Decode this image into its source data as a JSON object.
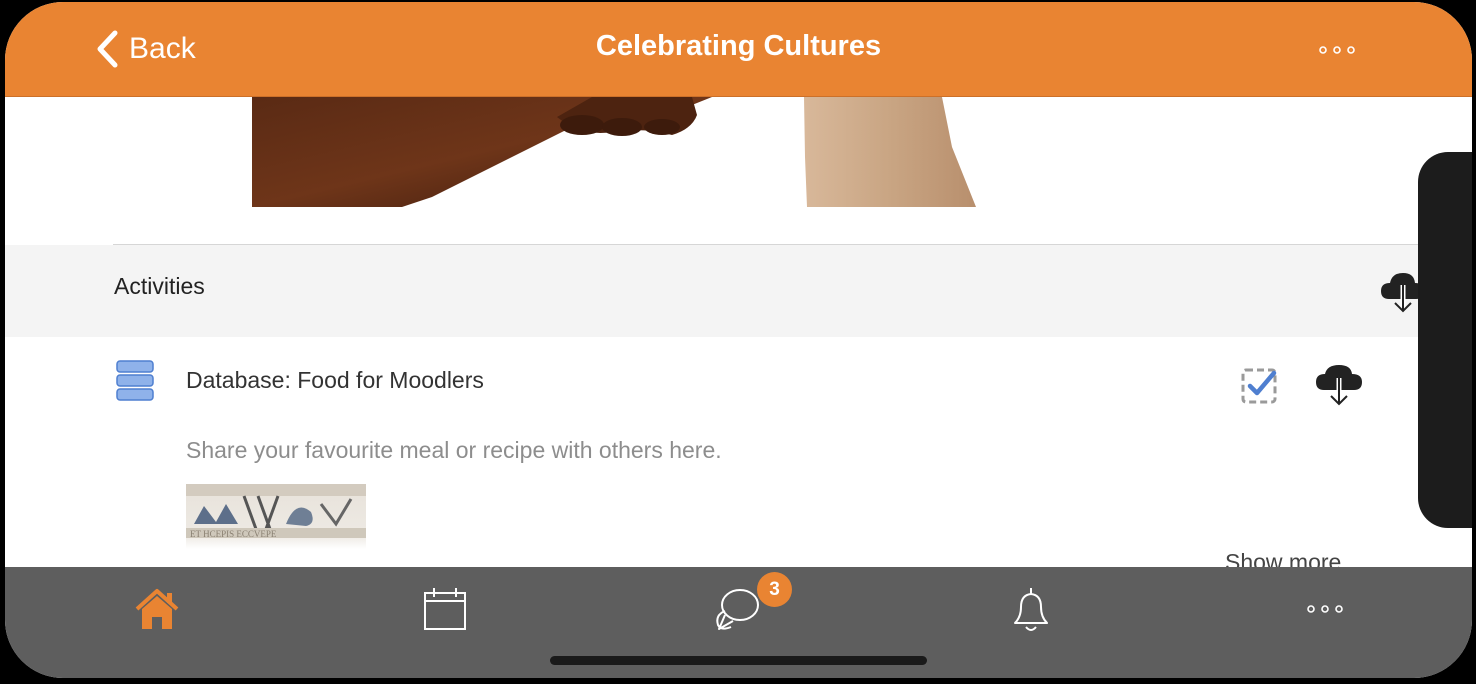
{
  "header": {
    "back_label": "Back",
    "title": "Celebrating Cultures"
  },
  "section": {
    "title": "Activities"
  },
  "module": {
    "title": "Database: Food for Moodlers",
    "description": "Share your favourite meal or recipe with others here.",
    "show_more": "Show more"
  },
  "tabbar": {
    "messages_badge": "3"
  },
  "icons": {
    "back": "chevron-left-icon",
    "more": "ellipsis-icon",
    "download": "cloud-download-icon",
    "database": "database-icon",
    "completion": "checkbox-checked-icon",
    "home": "home-icon",
    "calendar": "calendar-icon",
    "messages": "chat-bubbles-icon",
    "notifications": "bell-icon"
  },
  "colors": {
    "brand": "#e98432",
    "tabbar": "#5e5e5e",
    "section_bg": "#f4f4f4",
    "database_icon": "#6f9ae0"
  }
}
